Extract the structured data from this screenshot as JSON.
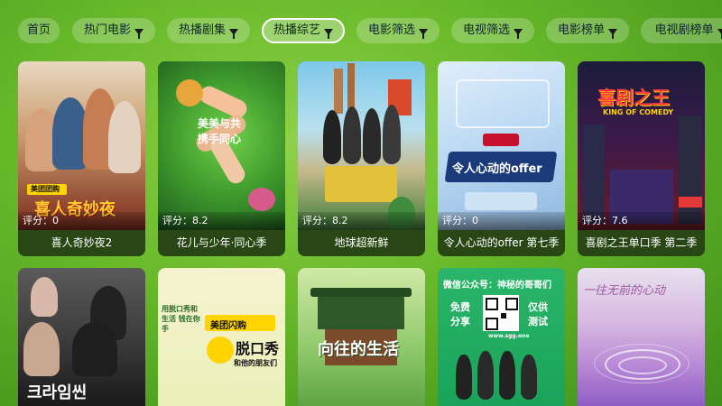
{
  "tabs": [
    {
      "label": "首页",
      "filter": false
    },
    {
      "label": "热门电影",
      "filter": true
    },
    {
      "label": "热播剧集",
      "filter": true
    },
    {
      "label": "热播综艺",
      "filter": true,
      "active": true
    },
    {
      "label": "电影筛选",
      "filter": true
    },
    {
      "label": "电视筛选",
      "filter": true
    },
    {
      "label": "电影榜单",
      "filter": true
    },
    {
      "label": "电视剧榜单",
      "filter": true
    }
  ],
  "rating_prefix": "评分：",
  "row1": [
    {
      "title": "喜人奇妙夜2",
      "rating": "0",
      "poster_text": "喜人奇妙夜",
      "brand": "美团团购"
    },
    {
      "title": "花儿与少年·同心季",
      "rating": "8.2",
      "poster_text": "美美与共 携手同心"
    },
    {
      "title": "地球超新鲜",
      "rating": "8.2"
    },
    {
      "title": "令人心动的offer 第七季",
      "rating": "0",
      "poster_text": "令人心动的offer"
    },
    {
      "title": "喜剧之王单口季 第二季",
      "rating": "7.6",
      "poster_text": "喜剧之王",
      "poster_sub": "KING OF COMEDY"
    }
  ],
  "row2": [
    {
      "poster_text": "크라임씬"
    },
    {
      "poster_text": "脱口秀",
      "poster_sub": "和他的朋友们",
      "brand": "美团闪购",
      "side": "用脱口秀和生活 钱在你手"
    },
    {
      "poster_text": "向往的生活"
    },
    {
      "poster_text": "微信公众号：神秘的哥哥们",
      "left": "免费 分享",
      "right": "仅供 测试",
      "url": "www.sgg.one"
    },
    {
      "poster_text": "一往无前的心动"
    }
  ],
  "colors": {
    "accent": "#ffffff",
    "title_bar": "#284614",
    "background": "#6bbb2c"
  }
}
